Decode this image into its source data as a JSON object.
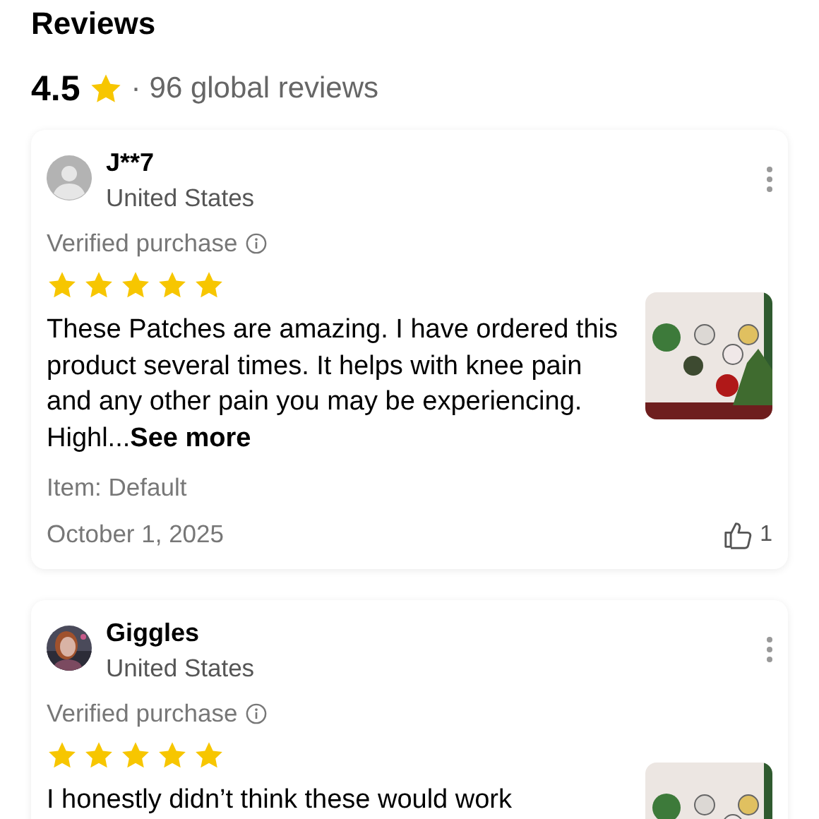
{
  "title": "Reviews",
  "summary": {
    "rating": "4.5",
    "separator": "·",
    "count": "96 global reviews"
  },
  "reviews": [
    {
      "name": "J**7",
      "country": "United States",
      "avatar": {
        "kind": "default"
      },
      "verified": "Verified purchase",
      "stars": 5,
      "text": "These Patches are amazing. I have ordered this product several times. It helps with knee pain and any other pain you may be experiencing. Highl...",
      "more": "See more",
      "item": "Item: Default",
      "date": "October 1, 2025",
      "likes": "1"
    },
    {
      "name": "Giggles",
      "country": "United States",
      "verified": "Verified purchase",
      "stars": 5,
      "text": "I honestly didn’t think these would work"
    }
  ]
}
